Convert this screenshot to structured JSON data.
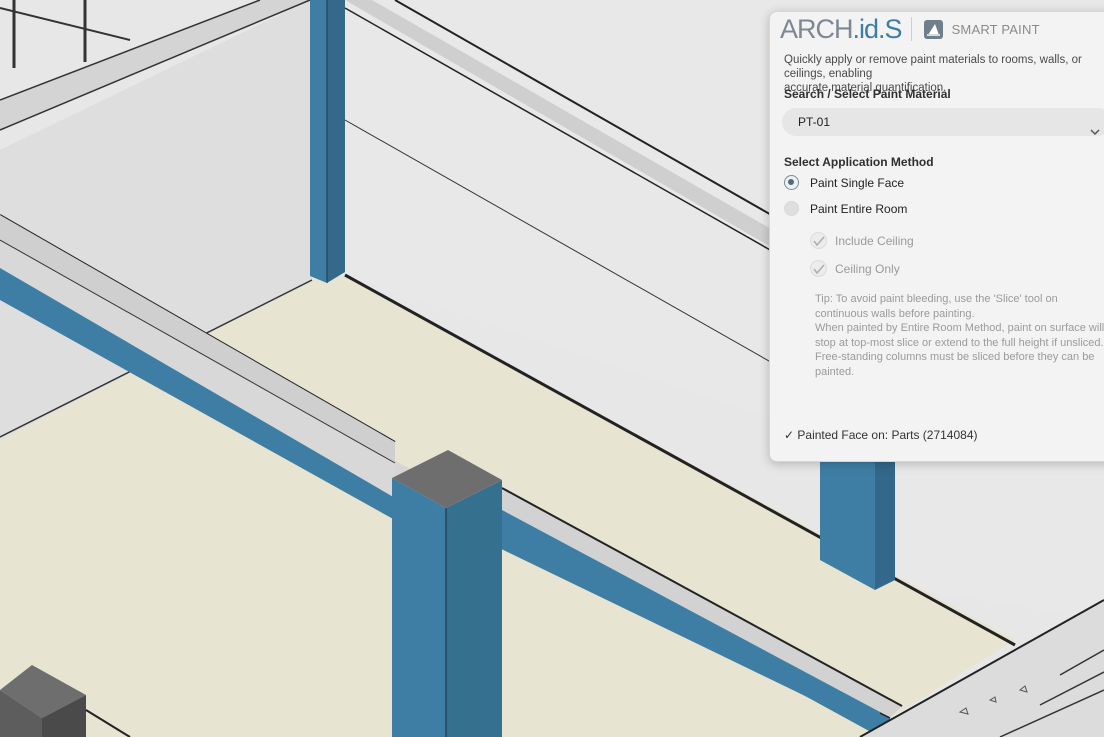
{
  "panel": {
    "brand": {
      "part1": "ARCH",
      "part2": ".id",
      "part3": ".S"
    },
    "title": "SMART PAINT",
    "description": "Quickly apply or remove paint materials to rooms, walls, or ceilings, enabling\naccurate material quantification.",
    "search_label": "Search / Select Paint Material",
    "selected_material": "PT-01",
    "method_label": "Select Application Method",
    "options": [
      {
        "label": "Paint Single Face",
        "selected": true
      },
      {
        "label": "Paint Entire Room",
        "selected": false
      }
    ],
    "sub_options": [
      {
        "label": "Include Ceiling",
        "checked": true,
        "enabled": false
      },
      {
        "label": "Ceiling Only",
        "checked": true,
        "enabled": false
      }
    ],
    "tip": "Tip: To avoid paint bleeding, use the 'Slice' tool on\ncontinuous walls before painting.\nWhen painted by Entire Room Method, paint on surface will\nstop at top-most slice or extend to the full height if unsliced.\nFree-standing columns must be sliced before they can be\npainted.",
    "status": "✓ Painted Face on: Parts (2714084)"
  },
  "colors": {
    "accent": "#3d7ea6",
    "painted_blue": "#3f7ea4",
    "floor": "#e8e4d2",
    "wall": "#e9e9e9"
  },
  "icons": [
    "smart-paint-icon",
    "chevron-down-icon",
    "checkmark-icon"
  ]
}
